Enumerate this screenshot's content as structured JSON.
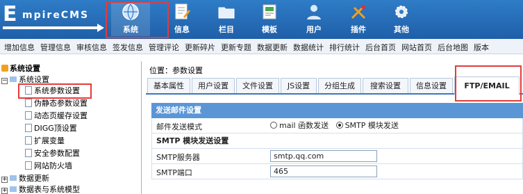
{
  "logo": {
    "big": "E",
    "rest": "mpireCMS"
  },
  "nav": {
    "tabs": [
      {
        "label": "系统",
        "icon": "globe-icon"
      },
      {
        "label": "信息",
        "icon": "document-edit-icon"
      },
      {
        "label": "栏目",
        "icon": "folder-icon"
      },
      {
        "label": "模板",
        "icon": "template-icon"
      },
      {
        "label": "用户",
        "icon": "user-icon"
      },
      {
        "label": "插件",
        "icon": "tools-icon"
      },
      {
        "label": "其他",
        "icon": "gear-icon"
      }
    ],
    "active": "系统"
  },
  "menubar": {
    "items": [
      "增加信息",
      "管理信息",
      "审核信息",
      "签发信息",
      "管理评论",
      "更新碎片",
      "更新专题",
      "数据更新",
      "数据统计",
      "排行统计",
      "后台首页",
      "网站首页",
      "后台地图",
      "版本"
    ]
  },
  "sidebar": {
    "root": "系统设置",
    "group": "系统设置",
    "items": [
      "系统参数设置",
      "伪静态参数设置",
      "动态页缓存设置",
      "DIGG顶设置",
      "扩展变量",
      "安全参数配置",
      "网站防火墙"
    ],
    "others": [
      "数据更新",
      "数据表与系统模型"
    ]
  },
  "main": {
    "breadcrumb": "位置：参数设置",
    "tabs": [
      "基本属性",
      "用户设置",
      "文件设置",
      "JS设置",
      "分组生成",
      "搜索设置",
      "信息设置",
      "FTP/EMAIL"
    ],
    "active_tab": "FTP/EMAIL",
    "section_title": "发送邮件设置",
    "mail_mode_label": "邮件发送模式",
    "mail_mode_opt1": "mail 函数发送",
    "mail_mode_opt2": "SMTP 模块发送",
    "smtp_subhead": "SMTP 模块发送设置",
    "smtp_server_label": "SMTP服务器",
    "smtp_server_value": "smtp.qq.com",
    "smtp_port_label": "SMTP端口",
    "smtp_port_value": "465"
  },
  "colors": {
    "header": "#2f7cc7",
    "highlight": "#e43b3b",
    "section": "#5a96d6"
  }
}
